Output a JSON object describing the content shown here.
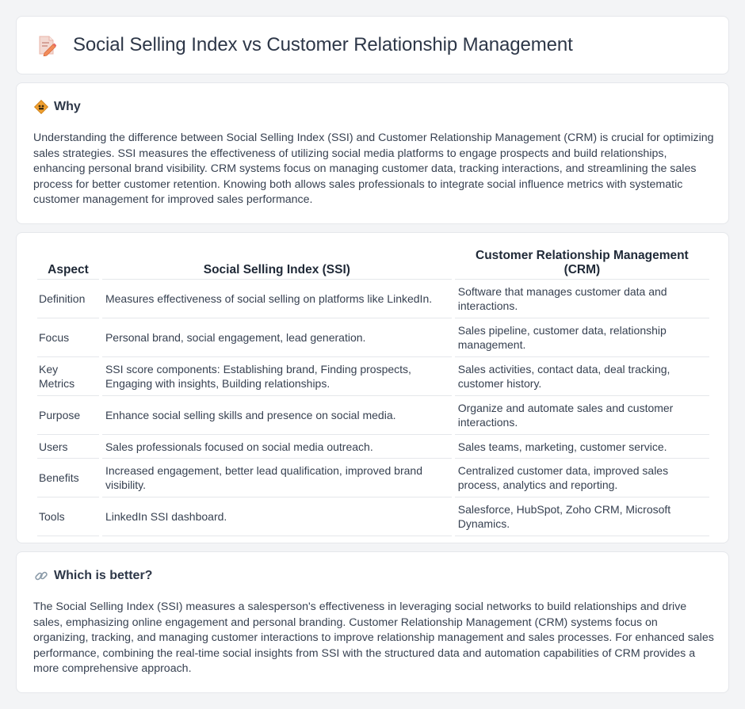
{
  "header": {
    "title": "Social Selling Index vs Customer Relationship Management",
    "icon": "document-pencil-icon"
  },
  "why": {
    "title": "Why",
    "icon": "diamond-sign-icon",
    "text": "Understanding the difference between Social Selling Index (SSI) and Customer Relationship Management (CRM) is crucial for optimizing sales strategies. SSI measures the effectiveness of utilizing social media platforms to engage prospects and build relationships, enhancing personal brand visibility. CRM systems focus on managing customer data, tracking interactions, and streamlining the sales process for better customer retention. Knowing both allows sales professionals to integrate social influence metrics with systematic customer management for improved sales performance."
  },
  "table": {
    "headers": [
      "Aspect",
      "Social Selling Index (SSI)",
      "Customer Relationship Management (CRM)"
    ],
    "rows": [
      {
        "aspect": "Definition",
        "ssi": "Measures effectiveness of social selling on platforms like LinkedIn.",
        "crm": "Software that manages customer data and interactions."
      },
      {
        "aspect": "Focus",
        "ssi": "Personal brand, social engagement, lead generation.",
        "crm": "Sales pipeline, customer data, relationship management."
      },
      {
        "aspect": "Key Metrics",
        "ssi": "SSI score components: Establishing brand, Finding prospects, Engaging with insights, Building relationships.",
        "crm": "Sales activities, contact data, deal tracking, customer history."
      },
      {
        "aspect": "Purpose",
        "ssi": "Enhance social selling skills and presence on social media.",
        "crm": "Organize and automate sales and customer interactions."
      },
      {
        "aspect": "Users",
        "ssi": "Sales professionals focused on social media outreach.",
        "crm": "Sales teams, marketing, customer service."
      },
      {
        "aspect": "Benefits",
        "ssi": "Increased engagement, better lead qualification, improved brand visibility.",
        "crm": "Centralized customer data, improved sales process, analytics and reporting."
      },
      {
        "aspect": "Tools",
        "ssi": "LinkedIn SSI dashboard.",
        "crm": "Salesforce, HubSpot, Zoho CRM, Microsoft Dynamics."
      }
    ]
  },
  "better": {
    "title": "Which is better?",
    "icon": "link-icon",
    "text": "The Social Selling Index (SSI) measures a salesperson's effectiveness in leveraging social networks to build relationships and drive sales, emphasizing online engagement and personal branding. Customer Relationship Management (CRM) systems focus on organizing, tracking, and managing customer interactions to improve relationship management and sales processes. For enhanced sales performance, combining the real-time social insights from SSI with the structured data and automation capabilities of CRM provides a more comprehensive approach."
  },
  "colors": {
    "background": "#f3f4f6",
    "card": "#ffffff",
    "border": "#e5e7eb",
    "icon_accent": "#f0a030"
  }
}
